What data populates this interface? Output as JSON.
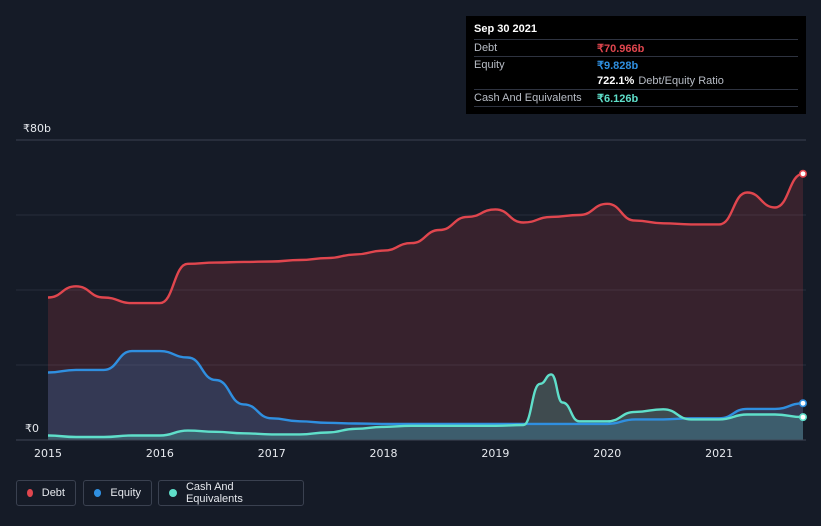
{
  "tooltip": {
    "date": "Sep 30 2021",
    "debt_label": "Debt",
    "debt_value": "₹70.966b",
    "equity_label": "Equity",
    "equity_value": "₹9.828b",
    "ratio_value": "722.1%",
    "ratio_label": "Debt/Equity Ratio",
    "cash_label": "Cash And Equivalents",
    "cash_value": "₹6.126b"
  },
  "legend": {
    "debt": "Debt",
    "equity": "Equity",
    "cash": "Cash And Equivalents"
  },
  "colors": {
    "debt": "#e0464e",
    "equity": "#2f8fe0",
    "cash": "#5fdfca",
    "background": "#151b27"
  },
  "chart_data": {
    "type": "area",
    "y_tick_labels": [
      "₹80b",
      "₹0"
    ],
    "ylim": [
      0,
      80
    ],
    "xlim": [
      2015,
      2021.75
    ],
    "x_ticks": [
      "2015",
      "2016",
      "2017",
      "2018",
      "2019",
      "2020",
      "2021"
    ],
    "grid": true,
    "legend_position": "bottom-left",
    "series": [
      {
        "name": "Debt",
        "x": [
          2015.0,
          2015.25,
          2015.5,
          2015.75,
          2016.0,
          2016.25,
          2016.5,
          2016.75,
          2017.0,
          2017.25,
          2017.5,
          2017.75,
          2018.0,
          2018.25,
          2018.5,
          2018.75,
          2019.0,
          2019.25,
          2019.5,
          2019.75,
          2020.0,
          2020.25,
          2020.5,
          2020.75,
          2021.0,
          2021.25,
          2021.5,
          2021.75
        ],
        "values": [
          38,
          41,
          38,
          36.5,
          36.5,
          47,
          47.3,
          47.5,
          47.6,
          48,
          48.5,
          49.5,
          50.5,
          52.5,
          56,
          59.5,
          61.5,
          58,
          59.5,
          60,
          63,
          58.5,
          57.8,
          57.5,
          57.5,
          66,
          62,
          71
        ]
      },
      {
        "name": "Equity",
        "x": [
          2015.0,
          2015.25,
          2015.5,
          2015.75,
          2016.0,
          2016.25,
          2016.5,
          2016.75,
          2017.0,
          2017.25,
          2017.5,
          2017.75,
          2018.0,
          2018.25,
          2018.5,
          2018.75,
          2019.0,
          2019.25,
          2019.5,
          2019.75,
          2020.0,
          2020.25,
          2020.5,
          2020.75,
          2021.0,
          2021.25,
          2021.5,
          2021.75
        ],
        "values": [
          18,
          18.7,
          18.7,
          23.7,
          23.7,
          22,
          16,
          9.5,
          5.8,
          5,
          4.6,
          4.4,
          4.3,
          4.3,
          4.3,
          4.3,
          4.3,
          4.3,
          4.3,
          4.3,
          4.3,
          5.5,
          5.5,
          5.8,
          5.8,
          8.3,
          8.3,
          9.8
        ]
      },
      {
        "name": "Cash And Equivalents",
        "x": [
          2015.0,
          2015.25,
          2015.5,
          2015.75,
          2016.0,
          2016.25,
          2016.5,
          2016.75,
          2017.0,
          2017.25,
          2017.5,
          2017.75,
          2018.0,
          2018.25,
          2018.5,
          2018.75,
          2019.0,
          2019.25,
          2019.4,
          2019.5,
          2019.6,
          2019.75,
          2020.0,
          2020.25,
          2020.5,
          2020.75,
          2021.0,
          2021.25,
          2021.5,
          2021.75
        ],
        "values": [
          1.2,
          0.8,
          0.8,
          1.2,
          1.2,
          2.5,
          2.2,
          1.8,
          1.5,
          1.5,
          2,
          3,
          3.5,
          3.8,
          3.8,
          3.8,
          3.8,
          4,
          15,
          17.5,
          10,
          5,
          5,
          7.5,
          8.2,
          5.5,
          5.5,
          6.8,
          6.8,
          6.1
        ]
      }
    ]
  }
}
